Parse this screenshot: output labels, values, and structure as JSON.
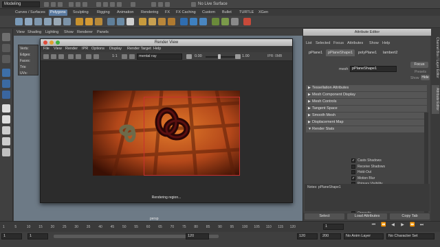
{
  "status_line": {
    "mode": "Modeling",
    "live_surface": "No Live Surface"
  },
  "shelf_tabs": [
    "Curves / Surfaces",
    "Polygons",
    "Sculpting",
    "Rigging",
    "Animation",
    "Rendering",
    "FX",
    "FX Caching",
    "Custom",
    "Bullet",
    "TURTLE",
    "XGen"
  ],
  "shelf_active": "Polygons",
  "panel_menu": [
    "View",
    "Shading",
    "Lighting",
    "Show",
    "Renderer",
    "Panels"
  ],
  "side_menu": [
    "Verts:",
    "Edges:",
    "Faces:",
    "Tris:",
    "UVs:"
  ],
  "viewport": {
    "camera": "persp"
  },
  "render_view": {
    "title": "Render View",
    "menus": [
      "File",
      "View",
      "Render",
      "IPR",
      "Options",
      "Display",
      "Render Target",
      "Help"
    ],
    "ratio": "1:1",
    "renderer": "mental ray",
    "exposure": "0.00",
    "gamma": "1.00",
    "ipr_size": "IPR: 0MB",
    "status": "Rendering region..."
  },
  "attribute_editor": {
    "title": "Attribute Editor",
    "menus": [
      "List",
      "Selected",
      "Focus",
      "Attributes",
      "Show",
      "Help"
    ],
    "tabs": [
      "pPlane1",
      "pPlaneShape1",
      "polyPlane1",
      "lambert2"
    ],
    "active_tab": "pPlaneShape1",
    "mesh_label": "mesh",
    "mesh_value": "pPlaneShape1",
    "focus_label": "Focus",
    "presets_label": "Presets",
    "show_label": "Show",
    "hide_label": "Hide",
    "sections": [
      {
        "label": "Tessellation Attributes",
        "open": false
      },
      {
        "label": "Mesh Component Display",
        "open": false
      },
      {
        "label": "Mesh Controls",
        "open": false
      },
      {
        "label": "Tangent Space",
        "open": false
      },
      {
        "label": "Smooth Mesh",
        "open": false
      },
      {
        "label": "Displacement Map",
        "open": false
      },
      {
        "label": "Render Stats",
        "open": true
      }
    ],
    "render_stats": [
      {
        "label": "Casts Shadows",
        "checked": true
      },
      {
        "label": "Receive Shadows",
        "checked": false
      },
      {
        "label": "Hold-Out",
        "checked": false
      },
      {
        "label": "Motion Blur",
        "checked": true
      },
      {
        "label": "Primary Visibility",
        "checked": false
      },
      {
        "label": "Smooth Shading",
        "checked": true
      },
      {
        "label": "Visible In Reflections",
        "checked": false
      },
      {
        "label": "Visible In Refractions",
        "checked": false
      },
      {
        "label": "Double Sided",
        "checked": true
      },
      {
        "label": "Opposite",
        "checked": false
      }
    ],
    "notes_label": "Notes:  pPlaneShape1",
    "buttons": [
      "Select",
      "Load Attributes",
      "Copy Tab"
    ]
  },
  "side_tabs": [
    "Channel Box / Layer Editor",
    "Attribute Editor"
  ],
  "timeline": {
    "ticks": [
      "1",
      "5",
      "10",
      "15",
      "20",
      "25",
      "30",
      "35",
      "40",
      "45",
      "50",
      "55",
      "60",
      "65",
      "70",
      "75",
      "80",
      "85",
      "90",
      "95",
      "100",
      "105",
      "110",
      "115",
      "120"
    ],
    "current": "1"
  },
  "range": {
    "start": "1",
    "start_inner": "1",
    "end_inner": "120",
    "end": "120",
    "end_outer": "200",
    "anim_layer": "No Anim Layer",
    "character_set": "No Character Set"
  }
}
